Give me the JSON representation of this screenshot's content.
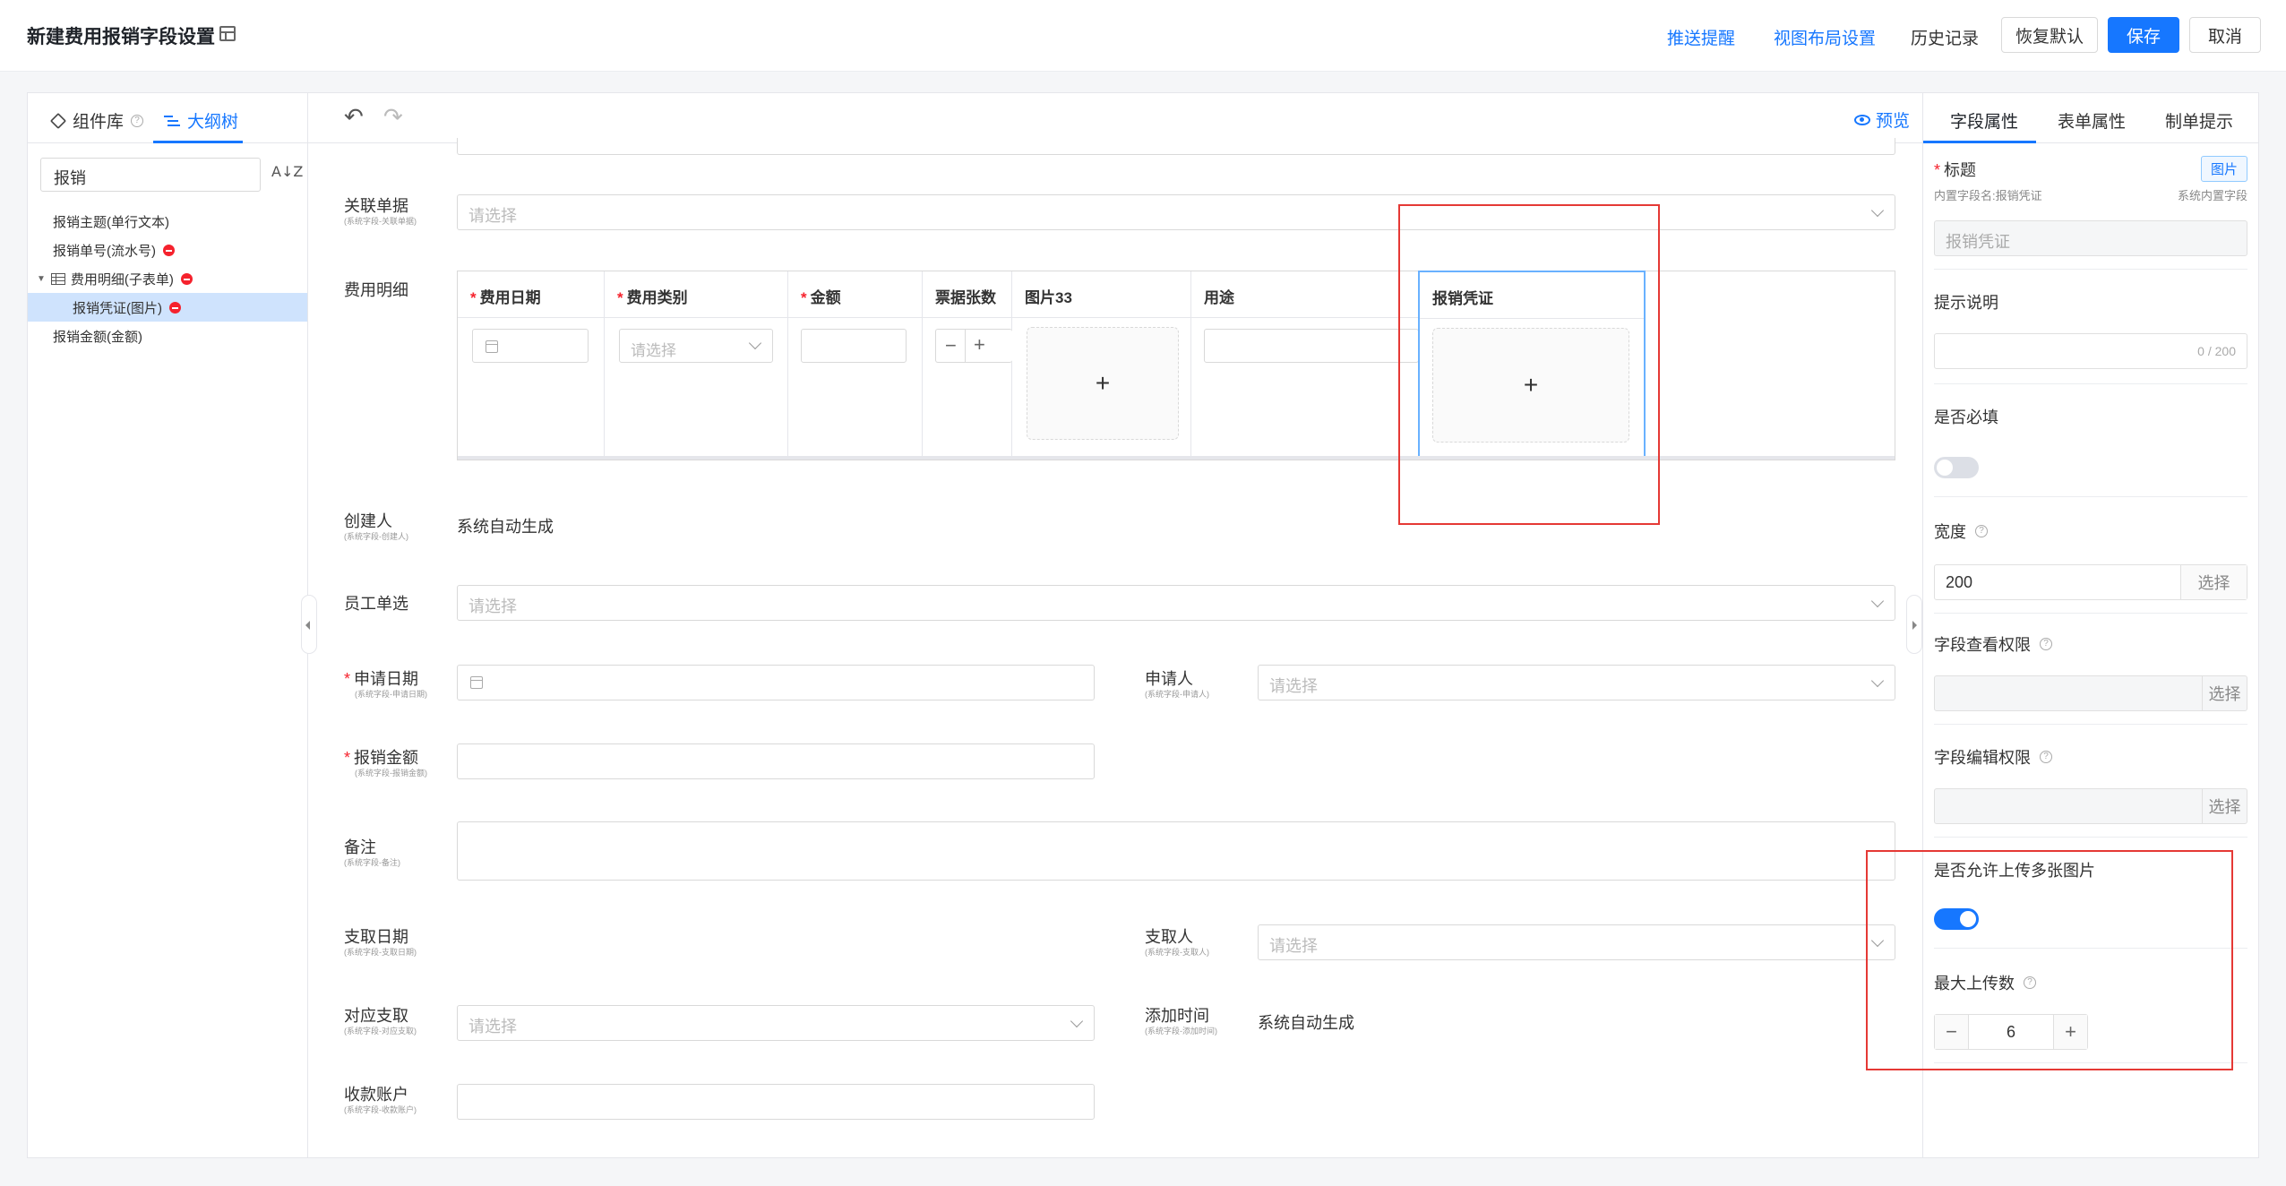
{
  "header": {
    "title": "新建费用报销字段设置",
    "push_reminder": "推送提醒",
    "view_layout": "视图布局设置",
    "history": "历史记录",
    "restore_default": "恢复默认",
    "save": "保存",
    "cancel": "取消"
  },
  "left_panel": {
    "tab_components": "组件库",
    "tab_outline": "大纲树",
    "search_value": "报销",
    "tree": [
      {
        "label": "报销主题(单行文本)",
        "removable": false
      },
      {
        "label": "报销单号(流水号)",
        "removable": true
      },
      {
        "label": "费用明细(子表单)",
        "removable": true
      },
      {
        "label": "报销凭证(图片)",
        "removable": true
      },
      {
        "label": "报销金额(金额)",
        "removable": false
      }
    ]
  },
  "toolbar": {
    "preview": "预览"
  },
  "form": {
    "related_doc": {
      "label": "关联单据",
      "sub": "(系统字段-关联单据)",
      "placeholder": "请选择"
    },
    "expense_detail": {
      "label": "费用明细",
      "columns": [
        "费用日期",
        "费用类别",
        "金额",
        "票据张数",
        "图片33",
        "用途",
        "报销凭证"
      ],
      "required_columns": [
        "费用日期",
        "费用类别",
        "金额"
      ],
      "category_placeholder": "请选择",
      "stepper_minus": "−",
      "stepper_plus": "+",
      "upload_plus": "+"
    },
    "creator": {
      "label": "创建人",
      "sub": "(系统字段-创建人)",
      "value": "系统自动生成"
    },
    "employee": {
      "label": "员工单选",
      "placeholder": "请选择"
    },
    "apply_date": {
      "label": "申请日期",
      "sub": "(系统字段-申请日期)"
    },
    "applicant": {
      "label": "申请人",
      "sub": "(系统字段-申请人)",
      "placeholder": "请选择"
    },
    "amount": {
      "label": "报销金额",
      "sub": "(系统字段-报销金额)"
    },
    "remark": {
      "label": "备注",
      "sub": "(系统字段-备注)"
    },
    "pay_date": {
      "label": "支取日期",
      "sub": "(系统字段-支取日期)"
    },
    "payer": {
      "label": "支取人",
      "sub": "(系统字段-支取人)",
      "placeholder": "请选择"
    },
    "pay_match": {
      "label": "对应支取",
      "sub": "(系统字段-对应支取)",
      "placeholder": "请选择"
    },
    "add_time": {
      "label": "添加时间",
      "sub": "(系统字段-添加时间)",
      "value": "系统自动生成"
    },
    "account": {
      "label": "收款账户",
      "sub": "(系统字段-收款账户)"
    }
  },
  "right_panel": {
    "tabs": [
      "字段属性",
      "表单属性",
      "制单提示"
    ],
    "title_label": "标题",
    "type_tag": "图片",
    "internal_name": "内置字段名:报销凭证",
    "system_field": "系统内置字段",
    "title_value": "报销凭证",
    "hint_label": "提示说明",
    "hint_count": "0 / 200",
    "required_label": "是否必填",
    "required_on": false,
    "width_label": "宽度",
    "width_value": "200",
    "select_label": "选择",
    "view_perm_label": "字段查看权限",
    "edit_perm_label": "字段编辑权限",
    "multi_upload_label": "是否允许上传多张图片",
    "multi_upload_on": true,
    "max_upload_label": "最大上传数",
    "max_upload_value": "6",
    "minus": "−",
    "plus": "+"
  },
  "colors": {
    "primary": "#1677ff",
    "highlight": "#e53935",
    "required": "#f5222d"
  }
}
